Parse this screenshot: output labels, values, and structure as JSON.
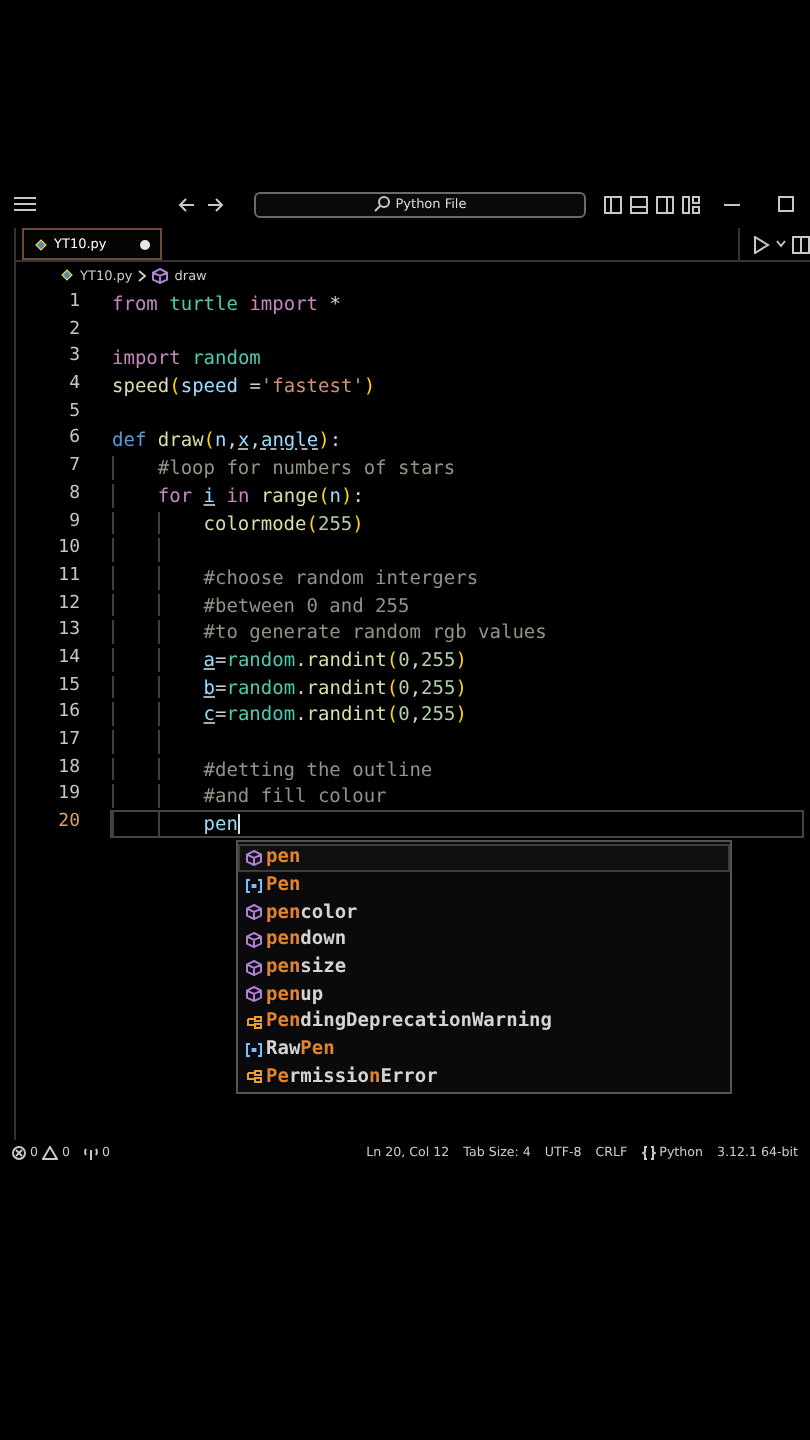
{
  "title_bar": {
    "search": "Python File"
  },
  "tabs": [
    {
      "label": "YT10.py",
      "selected": true,
      "modified": true
    }
  ],
  "breadcrumb": {
    "file": "YT10.py",
    "symbol": "draw"
  },
  "editor": {
    "lines": [
      {
        "number": "1",
        "current": false,
        "tokens": [
          {
            "kind": "keyword",
            "text": "from"
          },
          {
            "kind": "module",
            "text": " turtle"
          },
          {
            "kind": "keyword",
            "text": " import"
          },
          {
            "kind": "plain",
            "text": " *"
          }
        ]
      },
      {
        "number": "2",
        "current": false
      },
      {
        "number": "3",
        "current": false,
        "tokens": [
          {
            "kind": "keyword",
            "text": "import"
          },
          {
            "kind": "module",
            "text": " random"
          }
        ]
      },
      {
        "number": "4",
        "current": false,
        "tokens": [
          {
            "kind": "function",
            "text": "speed"
          },
          {
            "kind": "bracket",
            "text": "("
          },
          {
            "kind": "param",
            "text": "speed"
          },
          {
            "kind": "plain",
            "text": " ="
          },
          {
            "kind": "string",
            "text": "'fastest'"
          },
          {
            "kind": "bracket",
            "text": ")"
          }
        ]
      },
      {
        "number": "5",
        "current": false
      },
      {
        "number": "6",
        "current": false,
        "tokens": [
          {
            "kind": "storage",
            "text": "def"
          },
          {
            "kind": "function",
            "text": " draw"
          },
          {
            "kind": "bracket",
            "text": "("
          },
          {
            "kind": "param",
            "text": "n"
          },
          {
            "kind": "plain",
            "text": ","
          },
          {
            "kind": "warning",
            "text": "x"
          },
          {
            "kind": "plain",
            "text": ","
          },
          {
            "kind": "warning",
            "text": "angle"
          },
          {
            "kind": "bracket",
            "text": ")"
          },
          {
            "kind": "plain",
            "text": ":"
          }
        ]
      },
      {
        "number": "7",
        "current": false,
        "tokens": [
          {
            "kind": "comment",
            "text": "    #loop for numbers of stars"
          }
        ]
      },
      {
        "number": "8",
        "current": false,
        "tokens": [
          {
            "kind": "keyword",
            "text": "    for"
          },
          {
            "kind": "hint",
            "text": " i"
          },
          {
            "kind": "keyword",
            "text": " in"
          },
          {
            "kind": "function",
            "text": " range"
          },
          {
            "kind": "bracket",
            "text": "("
          },
          {
            "kind": "variable",
            "text": "n"
          },
          {
            "kind": "bracket",
            "text": ")"
          },
          {
            "kind": "plain",
            "text": ":"
          }
        ]
      },
      {
        "number": "9",
        "current": false,
        "tokens": [
          {
            "kind": "function",
            "text": "        colormode"
          },
          {
            "kind": "bracket",
            "text": "("
          },
          {
            "kind": "number",
            "text": "255"
          },
          {
            "kind": "bracket",
            "text": ")"
          }
        ]
      },
      {
        "number": "10",
        "current": false
      },
      {
        "number": "11",
        "current": false,
        "tokens": [
          {
            "kind": "comment",
            "text": "        #choose random intergers"
          }
        ]
      },
      {
        "number": "12",
        "current": false,
        "tokens": [
          {
            "kind": "comment",
            "text": "        #between 0 and 255"
          }
        ]
      },
      {
        "number": "13",
        "current": false,
        "tokens": [
          {
            "kind": "comment",
            "text": "        #to generate random rgb values"
          }
        ]
      },
      {
        "number": "14",
        "current": false,
        "tokens": [
          {
            "kind": "hint",
            "text": "        a"
          },
          {
            "kind": "plain",
            "text": "="
          },
          {
            "kind": "module",
            "text": "random"
          },
          {
            "kind": "plain",
            "text": "."
          },
          {
            "kind": "function",
            "text": "randint"
          },
          {
            "kind": "bracket",
            "text": "("
          },
          {
            "kind": "number",
            "text": "0"
          },
          {
            "kind": "plain",
            "text": ","
          },
          {
            "kind": "number",
            "text": "255"
          },
          {
            "kind": "bracket",
            "text": ")"
          }
        ]
      },
      {
        "number": "15",
        "current": false,
        "tokens": [
          {
            "kind": "hint",
            "text": "        b"
          },
          {
            "kind": "plain",
            "text": "="
          },
          {
            "kind": "module",
            "text": "random"
          },
          {
            "kind": "plain",
            "text": "."
          },
          {
            "kind": "function",
            "text": "randint"
          },
          {
            "kind": "bracket",
            "text": "("
          },
          {
            "kind": "number",
            "text": "0"
          },
          {
            "kind": "plain",
            "text": ","
          },
          {
            "kind": "number",
            "text": "255"
          },
          {
            "kind": "bracket",
            "text": ")"
          }
        ]
      },
      {
        "number": "16",
        "current": false,
        "tokens": [
          {
            "kind": "hint",
            "text": "        c"
          },
          {
            "kind": "plain",
            "text": "="
          },
          {
            "kind": "module",
            "text": "random"
          },
          {
            "kind": "plain",
            "text": "."
          },
          {
            "kind": "function",
            "text": "randint"
          },
          {
            "kind": "bracket",
            "text": "("
          },
          {
            "kind": "number",
            "text": "0"
          },
          {
            "kind": "plain",
            "text": ","
          },
          {
            "kind": "number",
            "text": "255"
          },
          {
            "kind": "bracket",
            "text": ")"
          }
        ]
      },
      {
        "number": "17",
        "current": false
      },
      {
        "number": "18",
        "current": false,
        "tokens": [
          {
            "kind": "comment",
            "text": "        #detting the outline"
          }
        ]
      },
      {
        "number": "19",
        "current": false,
        "tokens": [
          {
            "kind": "comment",
            "text": "        #and fill colour"
          }
        ]
      },
      {
        "number": "20",
        "current": true,
        "tokens": [
          {
            "kind": "variable",
            "text": "        pen"
          }
        ]
      }
    ]
  },
  "suggestions": [
    {
      "kind": "function",
      "selected": true,
      "parts": [
        {
          "text": "pen",
          "match": true
        }
      ]
    },
    {
      "kind": "variable",
      "selected": false,
      "parts": [
        {
          "text": "Pen",
          "match": true
        }
      ]
    },
    {
      "kind": "function",
      "selected": false,
      "parts": [
        {
          "text": "pen",
          "match": true
        },
        {
          "text": "color",
          "match": false
        }
      ]
    },
    {
      "kind": "function",
      "selected": false,
      "parts": [
        {
          "text": "pen",
          "match": true
        },
        {
          "text": "down",
          "match": false
        }
      ]
    },
    {
      "kind": "function",
      "selected": false,
      "parts": [
        {
          "text": "pen",
          "match": true
        },
        {
          "text": "size",
          "match": false
        }
      ]
    },
    {
      "kind": "function",
      "selected": false,
      "parts": [
        {
          "text": "pen",
          "match": true
        },
        {
          "text": "up",
          "match": false
        }
      ]
    },
    {
      "kind": "class",
      "selected": false,
      "parts": [
        {
          "text": "Pen",
          "match": true
        },
        {
          "text": "dingDeprecationWarning",
          "match": false
        }
      ]
    },
    {
      "kind": "variable",
      "selected": false,
      "parts": [
        {
          "text": "Raw",
          "match": false
        },
        {
          "text": "Pen",
          "match": true
        }
      ]
    },
    {
      "kind": "class",
      "selected": false,
      "parts": [
        {
          "text": "Pe",
          "match": true
        },
        {
          "text": "rmissio",
          "match": false
        },
        {
          "text": "n",
          "match": true
        },
        {
          "text": "Error",
          "match": false
        }
      ]
    }
  ],
  "status_bar": {
    "errors": "0",
    "warnings": "0",
    "ports": "0",
    "items": [
      "Ln 20, Col 12",
      "Tab Size: 4",
      "UTF-8",
      "CRLF"
    ],
    "language": "Python",
    "interpreter": "3.12.1 64-bit"
  }
}
